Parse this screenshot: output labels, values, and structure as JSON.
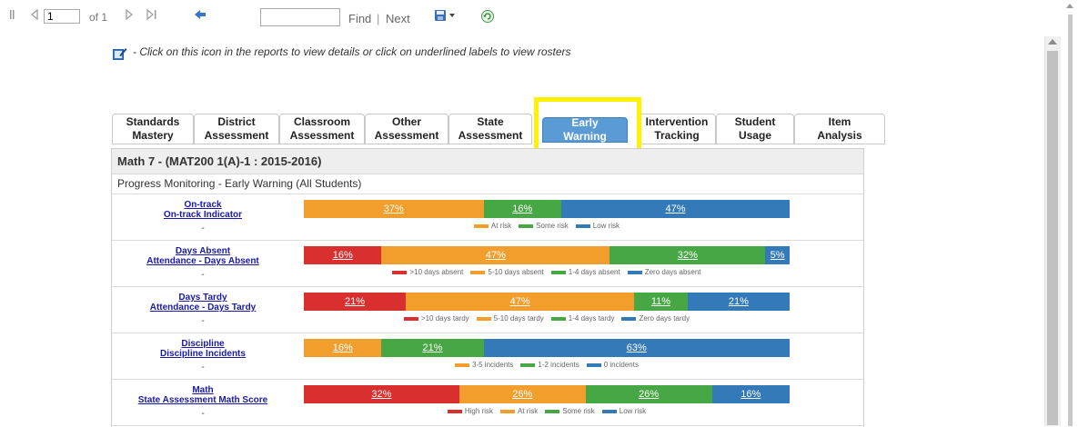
{
  "toolbar": {
    "first_icon": "first-page-icon",
    "prev_icon": "previous-page-icon",
    "page_value": "1",
    "page_of": "of 1",
    "next_icon": "next-page-icon",
    "last_icon": "last-page-icon",
    "back_icon": "back-icon",
    "find_value": "",
    "find_label": "Find",
    "separator": "|",
    "next_label": "Next",
    "export_icon": "save-export-icon",
    "refresh_icon": "refresh-icon"
  },
  "info_text": " - Click on this icon in the reports to view details or click on underlined labels to view rosters",
  "tabs": [
    {
      "line1": "Standards",
      "line2": "Mastery"
    },
    {
      "line1": "District",
      "line2": "Assessment"
    },
    {
      "line1": "Classroom",
      "line2": "Assessment"
    },
    {
      "line1": "Other",
      "line2": "Assessment"
    },
    {
      "line1": "State",
      "line2": "Assessment"
    },
    {
      "line1": "Early",
      "line2": "Warning"
    },
    {
      "line1": "Intervention",
      "line2": "Tracking"
    },
    {
      "line1": "Student",
      "line2": "Usage"
    },
    {
      "line1": "Item",
      "line2": "Analysis"
    }
  ],
  "active_tab": "Early Warning",
  "panel": {
    "title": "Math 7 - (MAT200 1(A)-1 : 2015-2016)",
    "subtitle": "Progress Monitoring - Early Warning (All Students)"
  },
  "colors": {
    "red": "#d9302f",
    "orange": "#f19e2d",
    "green": "#48a745",
    "blue": "#3479b8"
  },
  "rows": [
    {
      "label1": "On-track",
      "label2": "On-track Indicator",
      "dash": "-",
      "segments": [
        {
          "pct": 37,
          "text": "37%",
          "color": "#f19e2d"
        },
        {
          "pct": 16,
          "text": "16%",
          "color": "#48a745"
        },
        {
          "pct": 47,
          "text": "47%",
          "color": "#3479b8"
        }
      ],
      "legend": [
        {
          "text": "At risk",
          "color": "#f19e2d"
        },
        {
          "text": "Some risk",
          "color": "#48a745"
        },
        {
          "text": "Low risk",
          "color": "#3479b8"
        }
      ]
    },
    {
      "label1": "Days Absent",
      "label2": "Attendance - Days Absent",
      "dash": "-",
      "segments": [
        {
          "pct": 16,
          "text": "16%",
          "color": "#d9302f"
        },
        {
          "pct": 47,
          "text": "47%",
          "color": "#f19e2d"
        },
        {
          "pct": 32,
          "text": "32%",
          "color": "#48a745"
        },
        {
          "pct": 5,
          "text": "5%",
          "color": "#3479b8"
        }
      ],
      "legend": [
        {
          "text": ">10 days absent",
          "color": "#d9302f"
        },
        {
          "text": "5-10 days absent",
          "color": "#f19e2d"
        },
        {
          "text": "1-4 days absent",
          "color": "#48a745"
        },
        {
          "text": "Zero days absent",
          "color": "#3479b8"
        }
      ]
    },
    {
      "label1": "Days Tardy",
      "label2": "Attendance - Days Tardy",
      "dash": "-",
      "segments": [
        {
          "pct": 21,
          "text": "21%",
          "color": "#d9302f"
        },
        {
          "pct": 47,
          "text": "47%",
          "color": "#f19e2d"
        },
        {
          "pct": 11,
          "text": "11%",
          "color": "#48a745"
        },
        {
          "pct": 21,
          "text": "21%",
          "color": "#3479b8"
        }
      ],
      "legend": [
        {
          "text": ">10 days tardy",
          "color": "#d9302f"
        },
        {
          "text": "5-10 days tardy",
          "color": "#f19e2d"
        },
        {
          "text": "1-4 days tardy",
          "color": "#48a745"
        },
        {
          "text": "Zero days tardy",
          "color": "#3479b8"
        }
      ]
    },
    {
      "label1": "Discipline",
      "label2": "Discipline Incidents",
      "dash": "-",
      "segments": [
        {
          "pct": 16,
          "text": "16%",
          "color": "#f19e2d"
        },
        {
          "pct": 21,
          "text": "21%",
          "color": "#48a745"
        },
        {
          "pct": 63,
          "text": "63%",
          "color": "#3479b8"
        }
      ],
      "legend": [
        {
          "text": "3-5 incidents",
          "color": "#f19e2d"
        },
        {
          "text": "1-2 incidents",
          "color": "#48a745"
        },
        {
          "text": "0 incidents",
          "color": "#3479b8"
        }
      ]
    },
    {
      "label1": "Math",
      "label2": "State Assessment Math Score",
      "dash": "-",
      "segments": [
        {
          "pct": 32,
          "text": "32%",
          "color": "#d9302f"
        },
        {
          "pct": 26,
          "text": "26%",
          "color": "#f19e2d"
        },
        {
          "pct": 26,
          "text": "26%",
          "color": "#48a745"
        },
        {
          "pct": 16,
          "text": "16%",
          "color": "#3479b8"
        }
      ],
      "legend": [
        {
          "text": "High risk",
          "color": "#d9302f"
        },
        {
          "text": "At risk",
          "color": "#f19e2d"
        },
        {
          "text": "Some risk",
          "color": "#48a745"
        },
        {
          "text": "Low risk",
          "color": "#3479b8"
        }
      ]
    }
  ]
}
